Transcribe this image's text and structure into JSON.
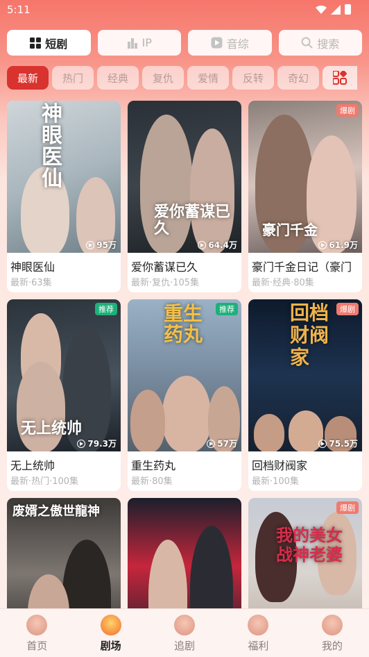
{
  "status_bar": {
    "time": "5:11"
  },
  "category_tabs": [
    {
      "label": "短剧",
      "icon": "grid-icon",
      "active": true
    },
    {
      "label": "IP",
      "icon": "bars-icon",
      "active": false
    },
    {
      "label": "音综",
      "icon": "play-icon",
      "active": false
    },
    {
      "label": "搜索",
      "icon": "search-icon",
      "active": false
    }
  ],
  "genres": [
    {
      "label": "最新",
      "active": true
    },
    {
      "label": "热门"
    },
    {
      "label": "经典"
    },
    {
      "label": "复仇"
    },
    {
      "label": "爱情"
    },
    {
      "label": "反转"
    },
    {
      "label": "奇幻"
    }
  ],
  "dramas": [
    {
      "title": "神眼医仙",
      "meta": "最新·63集",
      "views": "95万",
      "badge": "",
      "poster_text": "神眼医仙"
    },
    {
      "title": "爱你蓄谋已久",
      "meta": "最新·复仇·105集",
      "views": "64.4万",
      "badge": "",
      "poster_text": "爱你蓄谋已久"
    },
    {
      "title": "豪门千金日记（豪门",
      "meta": "最新·经典·80集",
      "views": "61.9万",
      "badge": "爆剧",
      "poster_text": "豪门千金"
    },
    {
      "title": "无上统帅",
      "meta": "最新·热门·100集",
      "views": "79.3万",
      "badge": "推荐",
      "poster_text": "无上统帅"
    },
    {
      "title": "重生药丸",
      "meta": "最新·80集",
      "views": "57万",
      "badge": "推荐",
      "poster_text": "重生药丸"
    },
    {
      "title": "回档财阀家",
      "meta": "最新·100集",
      "views": "75.5万",
      "badge": "爆剧",
      "poster_text": "回档财阀家"
    },
    {
      "title": "",
      "meta": "",
      "views": "",
      "badge": "",
      "poster_text": "废婿之傲世龍神"
    },
    {
      "title": "",
      "meta": "",
      "views": "",
      "badge": "",
      "poster_text": ""
    },
    {
      "title": "",
      "meta": "",
      "views": "",
      "badge": "爆剧",
      "poster_text": "我的美女战神老婆"
    }
  ],
  "bottom_nav": [
    {
      "label": "首页",
      "icon": "home-icon",
      "active": false
    },
    {
      "label": "剧场",
      "icon": "theater-icon",
      "active": true
    },
    {
      "label": "追剧",
      "icon": "follow-icon",
      "active": false
    },
    {
      "label": "福利",
      "icon": "welfare-icon",
      "active": false
    },
    {
      "label": "我的",
      "icon": "profile-icon",
      "active": false
    }
  ],
  "colors": {
    "accent": "#d9332f",
    "badge_hot": "#f07a6e",
    "badge_recommend": "#1fb07a",
    "header_gradient_top": "#f6766b"
  }
}
